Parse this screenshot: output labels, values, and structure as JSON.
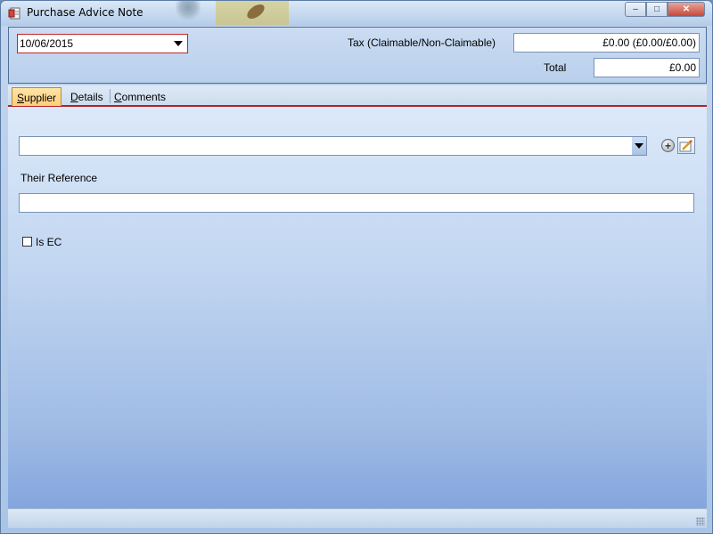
{
  "window": {
    "title": "Purchase Advice Note",
    "minimize_label": "–",
    "maximize_label": "□",
    "close_label": "✕"
  },
  "header": {
    "date_value": "10/06/2015",
    "tax_label": "Tax (Claimable/Non-Claimable)",
    "tax_value": "£0.00 (£0.00/£0.00)",
    "total_label": "Total",
    "total_value": "£0.00"
  },
  "tabs": [
    {
      "label_first": "S",
      "label_rest": "upplier",
      "active": true
    },
    {
      "label_first": "D",
      "label_rest": "etails",
      "active": false
    },
    {
      "label_first": "C",
      "label_rest": "omments",
      "active": false
    }
  ],
  "supplier": {
    "value": "",
    "add_glyph": "+"
  },
  "their_reference": {
    "label": "Their Reference",
    "value": ""
  },
  "is_ec": {
    "label": "Is EC",
    "checked": false
  }
}
